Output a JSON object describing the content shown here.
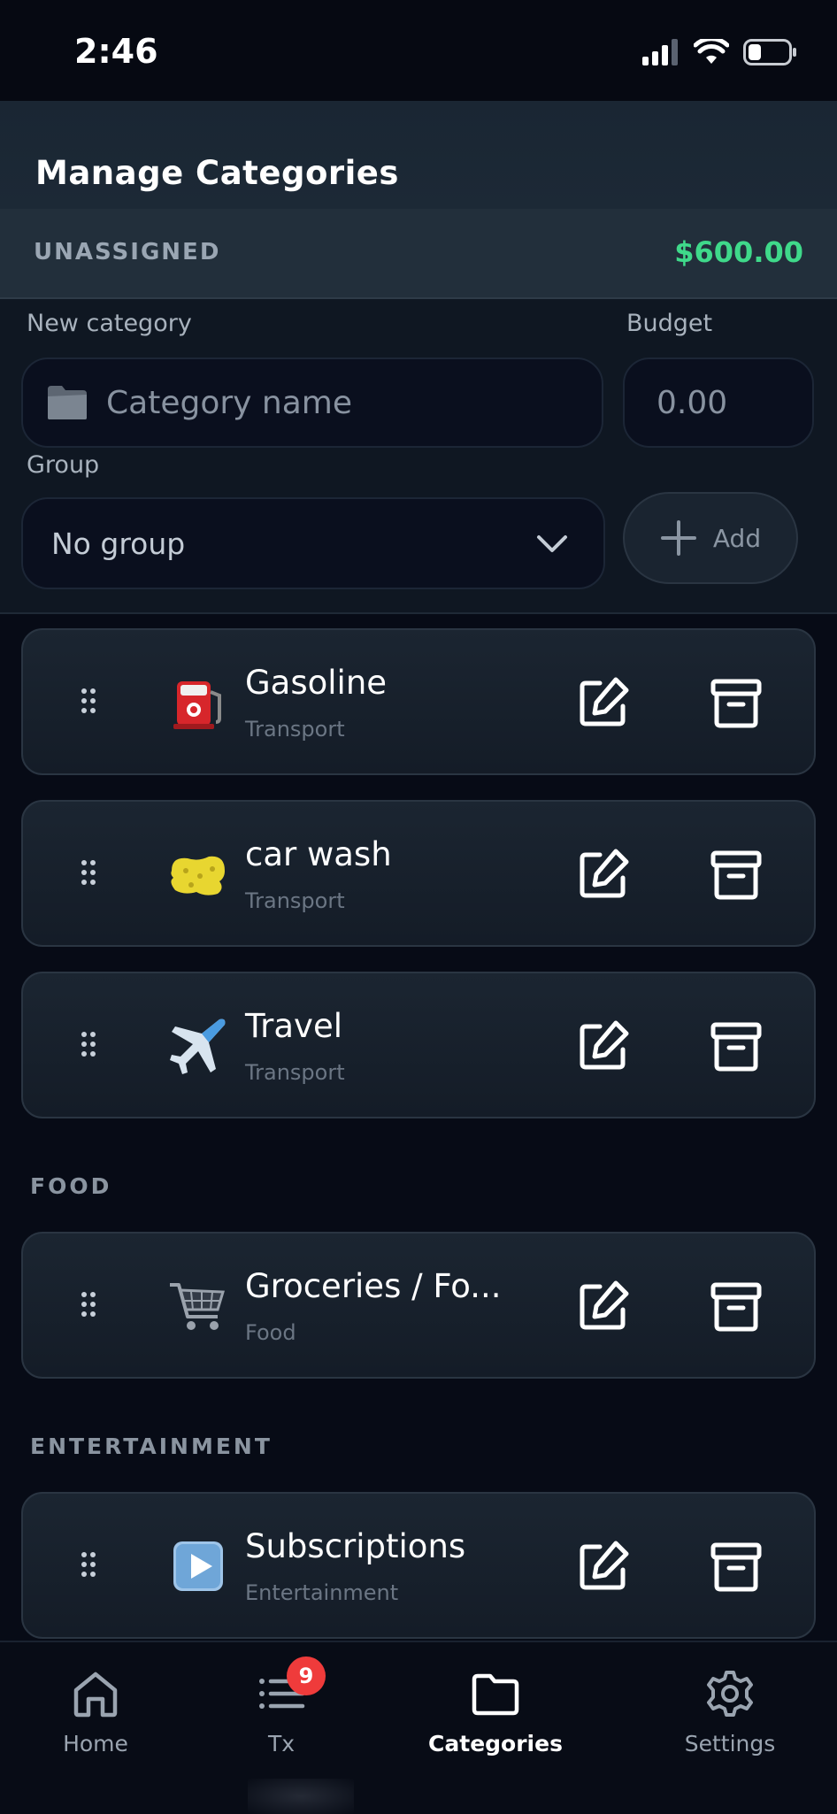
{
  "status": {
    "time": "2:46"
  },
  "header": {
    "title": "Manage Categories"
  },
  "unassigned": {
    "label": "UNASSIGNED",
    "amount": "$600.00"
  },
  "form": {
    "new_category_label": "New category",
    "name_placeholder": "Category name",
    "budget_label": "Budget",
    "budget_placeholder": "0.00",
    "group_label": "Group",
    "group_selected": "No group",
    "add_label": "Add"
  },
  "categories": [
    {
      "name": "Gasoline",
      "group": "Transport",
      "icon": "fuel-pump-icon"
    },
    {
      "name": "car wash",
      "group": "Transport",
      "icon": "sponge-icon"
    },
    {
      "name": "Travel",
      "group": "Transport",
      "icon": "airplane-icon"
    },
    {
      "name": "Groceries / Fo...",
      "group": "Food",
      "icon": "shopping-cart-icon"
    },
    {
      "name": "Subscriptions",
      "group": "Entertainment",
      "icon": "play-button-icon"
    }
  ],
  "sections": {
    "food": "FOOD",
    "entertainment": "ENTERTAINMENT"
  },
  "tabs": [
    {
      "label": "Home",
      "icon": "home-icon"
    },
    {
      "label": "Tx",
      "icon": "list-icon",
      "badge": "9"
    },
    {
      "label": "Categories",
      "icon": "folder-icon",
      "active": true
    },
    {
      "label": "Settings",
      "icon": "gear-icon"
    }
  ],
  "colors": {
    "accent_green": "#3fd98a",
    "badge_red": "#ef3b3b",
    "background": "#070b16"
  }
}
